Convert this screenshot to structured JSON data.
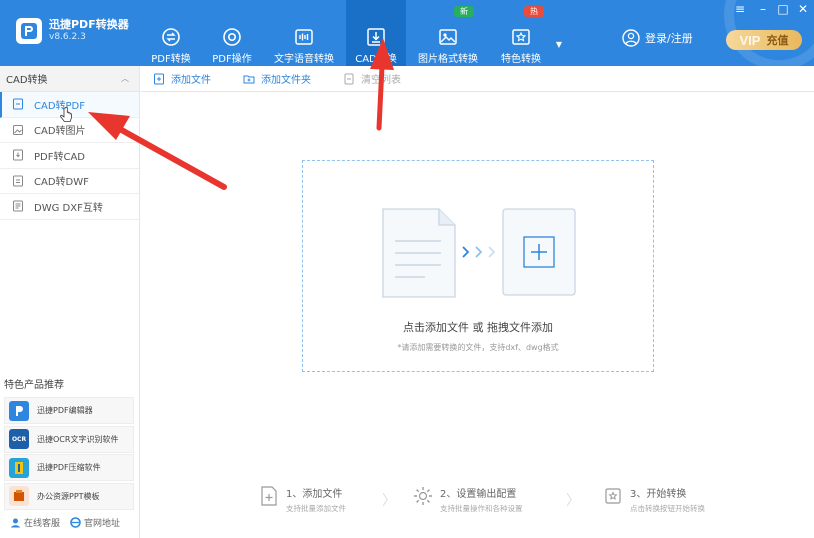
{
  "app": {
    "title": "迅捷PDF转换器",
    "version": "v8.6.2.3"
  },
  "nav": {
    "items": [
      {
        "label": "PDF转换",
        "icon": "pdf-convert-icon"
      },
      {
        "label": "PDF操作",
        "icon": "pdf-operate-icon"
      },
      {
        "label": "文字语音转换",
        "icon": "voice-icon"
      },
      {
        "label": "CAD转换",
        "icon": "cad-convert-icon",
        "active": true
      },
      {
        "label": "图片格式转换",
        "icon": "image-icon",
        "badge": "新",
        "badge_color": "#27ae60"
      },
      {
        "label": "特色转换",
        "icon": "special-icon",
        "badge": "热",
        "badge_color": "#e74c3c"
      }
    ]
  },
  "header": {
    "login_label": "登录/注册",
    "vip_text": "VIP",
    "vip_label": "充值",
    "win_min": "–",
    "win_menu": "≡",
    "win_max": "□",
    "win_close": "✕"
  },
  "sidebar": {
    "section_title": "CAD转换",
    "items": [
      {
        "label": "CAD转PDF",
        "active": true
      },
      {
        "label": "CAD转图片"
      },
      {
        "label": "PDF转CAD"
      },
      {
        "label": "CAD转DWF"
      },
      {
        "label": "DWG DXF互转"
      }
    ],
    "featured_title": "特色产品推荐",
    "featured": [
      {
        "label": "迅捷PDF编辑器",
        "color": "#2e86de"
      },
      {
        "label": "迅捷OCR文字识别软件",
        "color": "#1d5fa8"
      },
      {
        "label": "迅捷PDF压缩软件",
        "color": "#27a3d9"
      },
      {
        "label": "办公资源PPT模板",
        "color": "#d35400"
      }
    ],
    "footer": {
      "service_label": "在线客服",
      "website_label": "官网地址"
    }
  },
  "toolbar": {
    "add_file": "添加文件",
    "add_folder": "添加文件夹",
    "clear_list": "清空列表"
  },
  "dropzone": {
    "main_text": "点击添加文件 或 拖拽文件添加",
    "sub_text": "*请添加需要转换的文件，支持dxf、dwg格式"
  },
  "steps": [
    {
      "title": "1、添加文件",
      "desc": "支持批量添加文件"
    },
    {
      "title": "2、设置输出配置",
      "desc": "支持批量操作和各种设置"
    },
    {
      "title": "3、开始转换",
      "desc": "点击转换按钮开始转换"
    }
  ],
  "colors": {
    "accent": "#2e86de",
    "header_active": "#1a6fc7",
    "annotation_red": "#e8352e"
  }
}
